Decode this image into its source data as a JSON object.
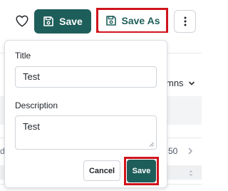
{
  "toolbar": {
    "save_label": "Save",
    "save_as_label": "Save As"
  },
  "background": {
    "columns_fragment": "mns",
    "page_value_fragment": "50",
    "row_fragment": "d"
  },
  "popover": {
    "title_label": "Title",
    "title_value": "Test",
    "description_label": "Description",
    "description_value": "Test",
    "cancel_label": "Cancel",
    "save_label": "Save"
  },
  "colors": {
    "primary": "#1e5e5a",
    "highlight": "#d0141c"
  },
  "icons": [
    "heart-icon",
    "floppy-disk-icon",
    "vertical-ellipsis-icon",
    "chevron-down-icon",
    "chevron-right-icon",
    "sort-icon"
  ]
}
